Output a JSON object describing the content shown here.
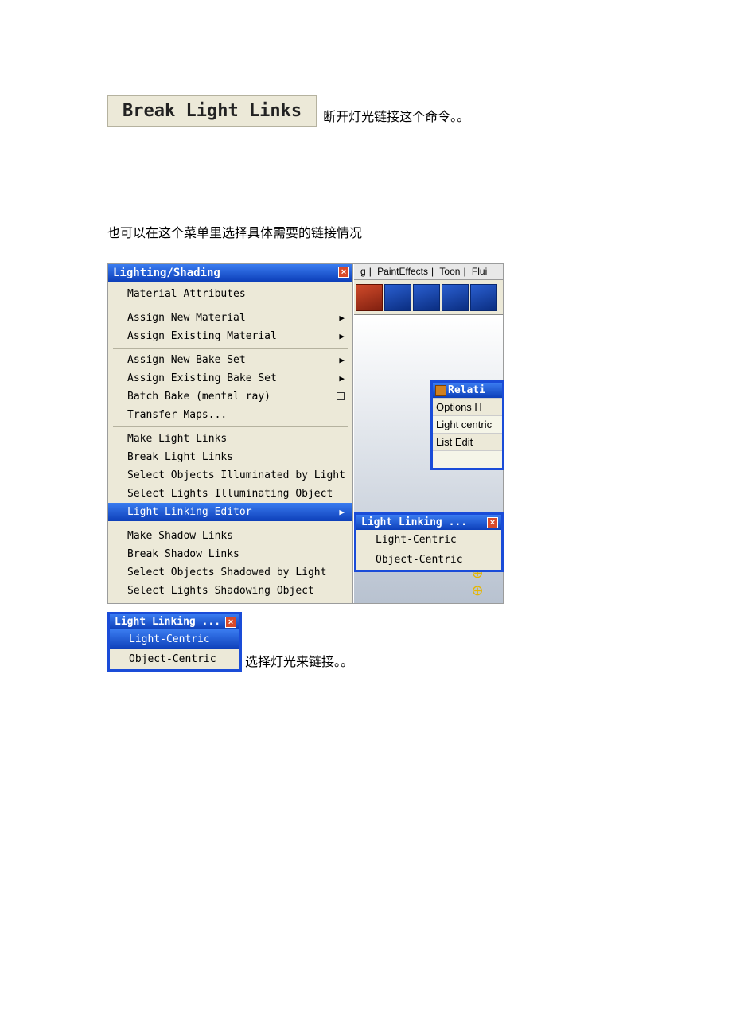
{
  "header": {
    "button_label": "Break Light Links",
    "caption": "断开灯光链接这个命令。。"
  },
  "section_note": "也可以在这个菜单里选择具体需要的链接情况",
  "menu": {
    "title": "Lighting/Shading",
    "items_block1": [
      "Material Attributes"
    ],
    "items_block2": [
      "Assign New Material",
      "Assign Existing Material"
    ],
    "items_block3": [
      "Assign New Bake Set",
      "Assign Existing Bake Set",
      "Batch Bake (mental ray)",
      "Transfer Maps..."
    ],
    "items_block4": [
      "Make Light Links",
      "Break Light Links",
      "Select Objects Illuminated by Light",
      "Select Lights Illuminating Object",
      "Light Linking Editor"
    ],
    "items_block5": [
      "Make Shadow Links",
      "Break Shadow Links",
      "Select Objects Shadowed by Light",
      "Select Lights Shadowing Object"
    ]
  },
  "top_tabs": {
    "a": "g",
    "b": "PaintEffects",
    "c": "Toon",
    "d": "Flui"
  },
  "relat_panel": {
    "title": "Relati",
    "row1": "Options  H",
    "row2": "Light centric",
    "row3": "List  Edit"
  },
  "submenu": {
    "title": "Light Linking ...",
    "items": [
      "Light-Centric",
      "Object-Centric"
    ]
  },
  "small": {
    "title": "Light Linking ...",
    "items": [
      "Light-Centric",
      "Object-Centric"
    ],
    "caption": "选择灯光来链接。。"
  }
}
